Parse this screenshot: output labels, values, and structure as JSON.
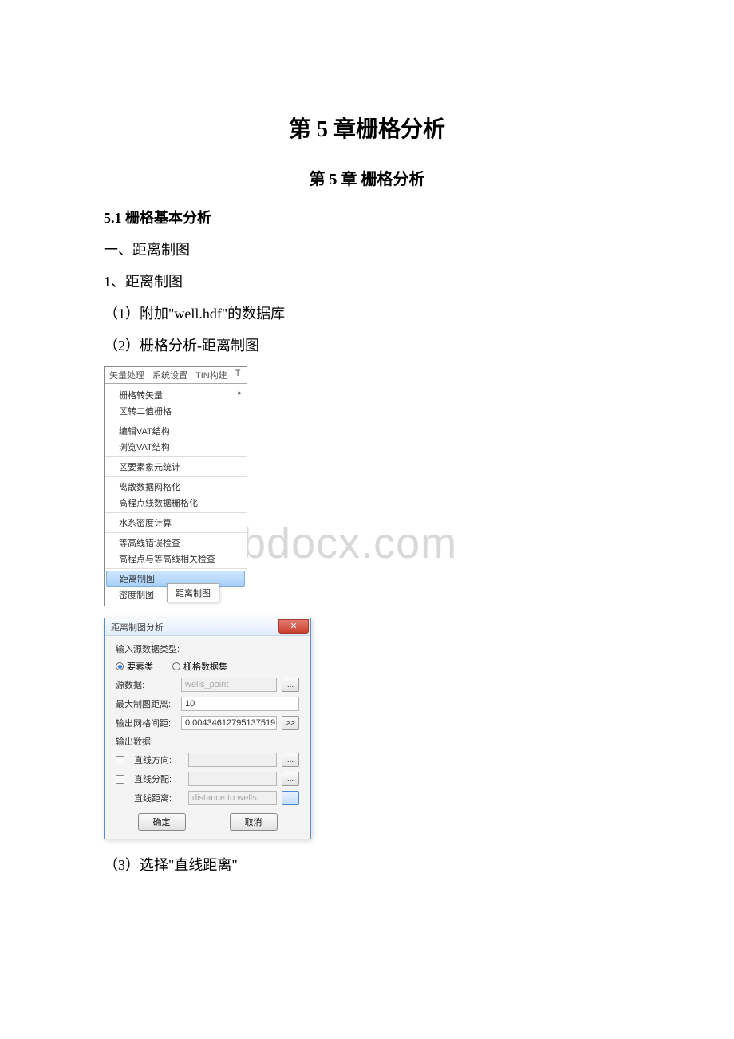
{
  "watermark": "www.bdocx.com",
  "title_main": "第 5 章栅格分析",
  "title_sub": "第 5 章 栅格分析",
  "section_51": "5.1 栅格基本分析",
  "line_a": "一、距离制图",
  "line_b": "1、距离制图",
  "line_c": "（1）附加\"well.hdf\"的数据库",
  "line_d": "（2）栅格分析-距离制图",
  "line_e": "（3）选择\"直线距离\"",
  "menu": {
    "bar": {
      "a": "矢量处理",
      "b": "系统设置",
      "c": "TIN构建",
      "d": "T"
    },
    "g1": {
      "m1": "栅格转矢量",
      "m2": "区转二值栅格"
    },
    "g2": {
      "m1": "编辑VAT结构",
      "m2": "浏览VAT结构"
    },
    "g3": {
      "m1": "区要素象元统计"
    },
    "g4": {
      "m1": "离散数据网格化",
      "m2": "高程点线数据栅格化"
    },
    "g5": {
      "m1": "水系密度计算"
    },
    "g6": {
      "m1": "等高线错误检查",
      "m2": "高程点与等高线相关检查"
    },
    "g7": {
      "m1": "距离制图",
      "m2": "密度制图"
    },
    "flyout": "距离制图"
  },
  "dialog": {
    "title": "距离制图分析",
    "close_x": "✕",
    "srctype_label": "输入源数据类型:",
    "radio_feature": "要素类",
    "radio_raster": "栅格数据集",
    "src_label": "源数据:",
    "src_value": "wells_point",
    "maxdist_label": "最大制图距离:",
    "maxdist_value": "10",
    "cell_label": "输出网格间距:",
    "cell_value": "0.00434612795137519",
    "outdata_label": "输出数据:",
    "straightdir_label": "直线方向:",
    "straightalloc_label": "直线分配:",
    "straightdist_label": "直线距离:",
    "straightdist_value": "distance to wells",
    "browse": "...",
    "expand": ">>",
    "ok": "确定",
    "cancel": "取消"
  }
}
